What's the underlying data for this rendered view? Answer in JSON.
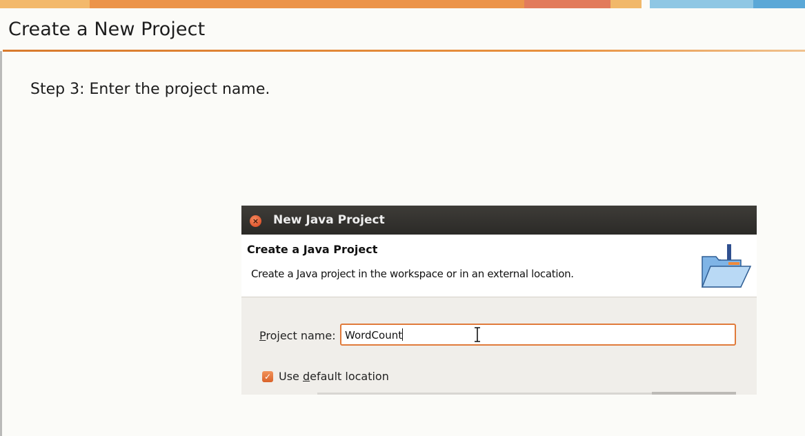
{
  "slide": {
    "title": "Create a New Project",
    "step": "Step 3: Enter the project name."
  },
  "theme": {
    "strip_colors": [
      "#f2b76a",
      "#ea9045",
      "#e17a5d",
      "#f0b469",
      "#8fc6e3",
      "#58a7d6"
    ],
    "accent": "#e07a3a",
    "titlebar": "#2b2a27"
  },
  "dialog": {
    "window_title": "New Java Project",
    "header_title": "Create a Java Project",
    "header_desc": "Create a Java project in the workspace or in an external location.",
    "close_glyph": "×",
    "project_name_label_prefix": "P",
    "project_name_label_rest": "roject name:",
    "project_name_value": "WordCount",
    "checkbox_checked": true,
    "checkbox_glyph": "✓",
    "use_default_prefix": "Use ",
    "use_default_accel": "d",
    "use_default_rest": "efault location",
    "icons": {
      "close": "close-icon",
      "header": "java-project-folder-icon",
      "cursor": "text-cursor-icon"
    }
  }
}
